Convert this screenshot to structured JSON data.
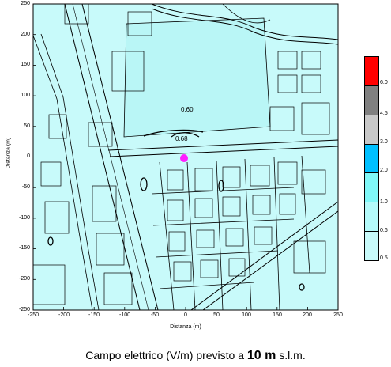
{
  "map": {
    "y_ticks": [
      "250",
      "200",
      "150",
      "100",
      "50",
      "0",
      "-50",
      "-100",
      "-150",
      "-200",
      "-250"
    ],
    "x_ticks": [
      "-250",
      "-200",
      "-150",
      "-100",
      "-50",
      "0",
      "50",
      "100",
      "150",
      "200",
      "250"
    ],
    "y_label": "Distanza (m)",
    "x_label": "Distanza (m)",
    "contour_labels": [
      "0.60",
      "0.68"
    ],
    "background_color": "#c8fafa",
    "source_marker_color": "#ff1fff"
  },
  "legend": {
    "levels": [
      {
        "label": "6.0",
        "color": "#ff0000"
      },
      {
        "label": "4.5",
        "color": "#808080"
      },
      {
        "label": "3.0",
        "color": "#c8c8c8"
      },
      {
        "label": "2.0",
        "color": "#00c0ff"
      },
      {
        "label": "1.0",
        "color": "#80f8f8"
      },
      {
        "label": "0.6",
        "color": "#b4fafa"
      },
      {
        "label": "0.5",
        "color": "#c8fafa"
      }
    ]
  },
  "caption": {
    "prefix": "Campo elettrico (V/m) previsto a",
    "height": "10 m",
    "suffix": "s.l.m."
  }
}
